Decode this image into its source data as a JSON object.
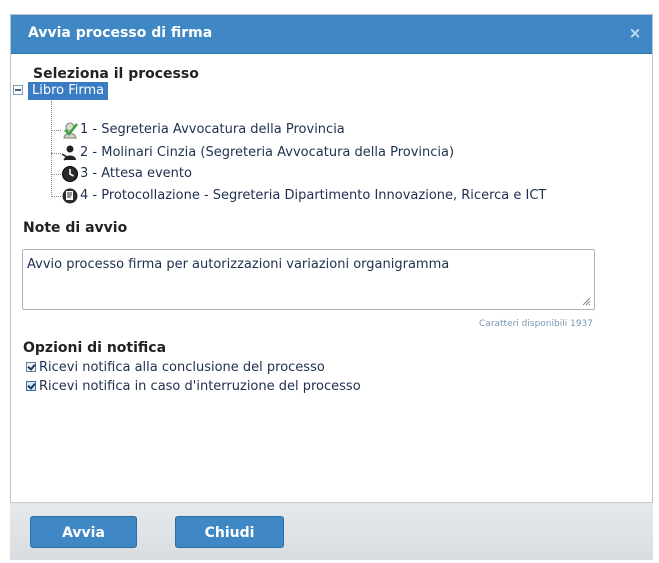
{
  "dialog": {
    "title": "Avvia processo di firma",
    "close_glyph": "×"
  },
  "process": {
    "heading": "Seleziona il processo",
    "root_label": "Libro Firma",
    "steps": [
      {
        "label": "1 - Segreteria Avvocatura della Provincia",
        "icon": "green-check-user-icon"
      },
      {
        "label": "2 - Molinari Cinzia (Segreteria Avvocatura della Provincia)",
        "icon": "user-sign-icon"
      },
      {
        "label": "3 - Attesa evento",
        "icon": "clock-icon"
      },
      {
        "label": "4 - Protocollazione - Segreteria Dipartimento Innovazione, Ricerca e ICT",
        "icon": "protocol-document-icon"
      }
    ]
  },
  "notes": {
    "heading": "Note di avvio",
    "value": "Avvio processo firma per autorizzazioni variazioni organigramma",
    "chars_available": "Caratteri disponibili 1937"
  },
  "notifications": {
    "heading": "Opzioni di notifica",
    "options": [
      {
        "label": "Ricevi notifica alla conclusione del processo",
        "checked": true
      },
      {
        "label": "Ricevi notifica in caso d'interruzione del processo",
        "checked": true
      }
    ]
  },
  "buttons": {
    "start": "Avvia",
    "close": "Chiudi"
  },
  "colors": {
    "accent": "#3f88c5",
    "selected": "#3a7cc4",
    "text": "#1f2f50"
  }
}
